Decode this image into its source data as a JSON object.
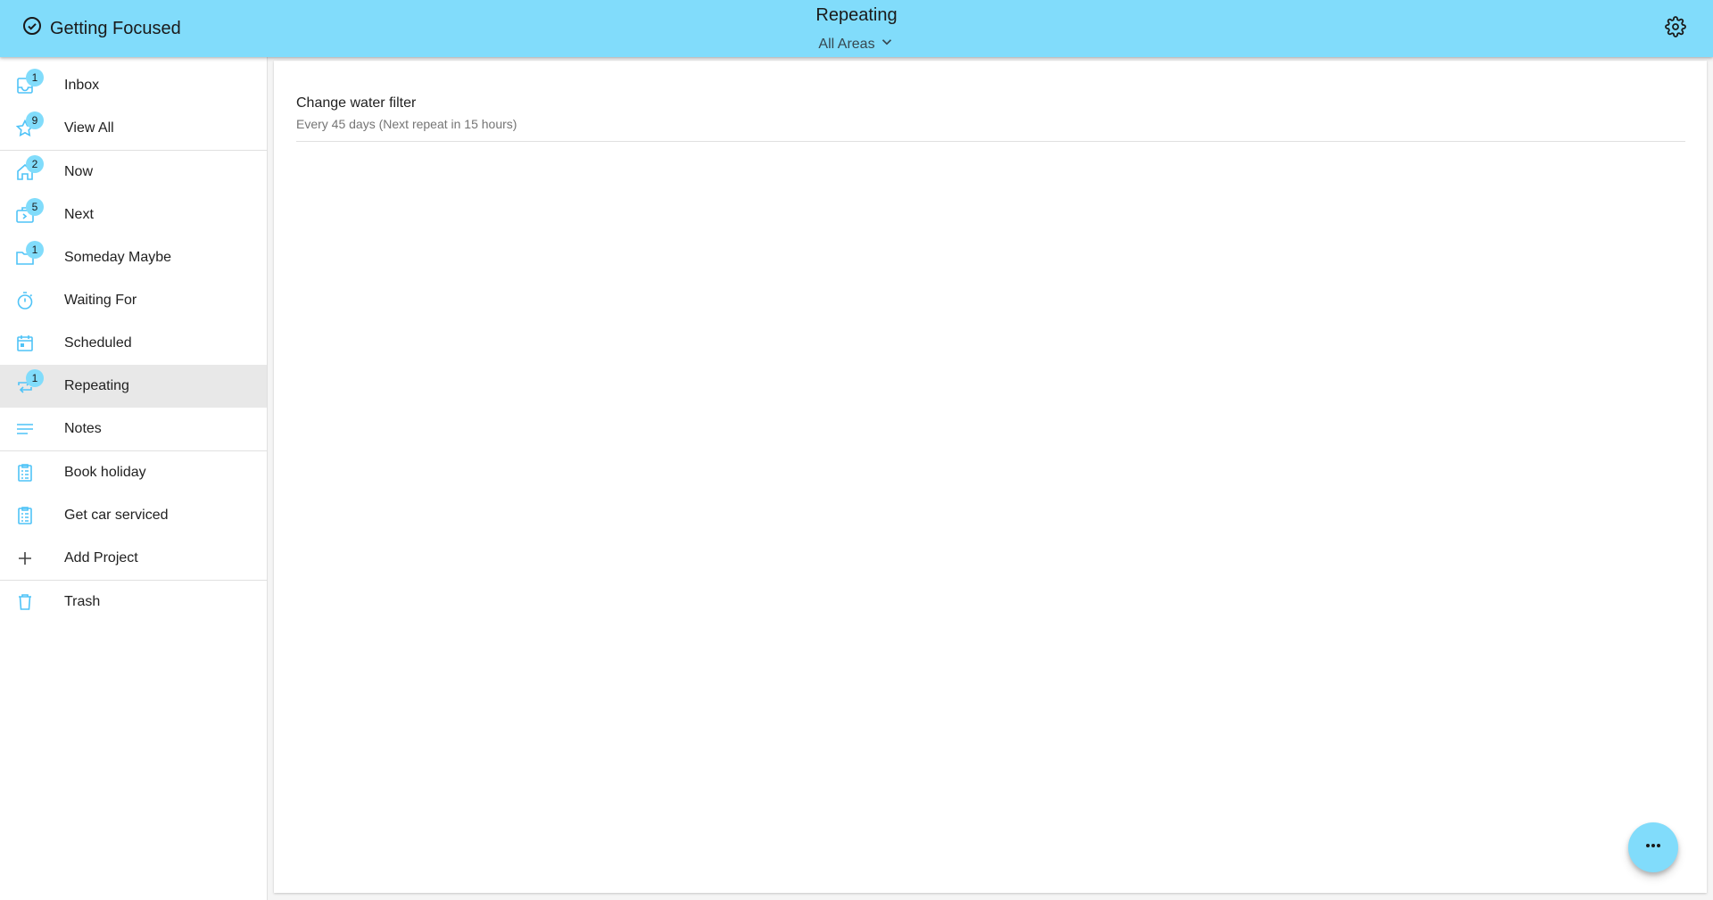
{
  "header": {
    "brand": "Getting Focused",
    "title": "Repeating",
    "area_filter": "All Areas"
  },
  "sidebar": {
    "groups": [
      {
        "items": [
          {
            "label": "Inbox",
            "badge": "1",
            "icon": "inbox-icon"
          },
          {
            "label": "View All",
            "badge": "9",
            "icon": "star-icon"
          }
        ]
      },
      {
        "items": [
          {
            "label": "Now",
            "badge": "2",
            "icon": "home-icon"
          },
          {
            "label": "Next",
            "badge": "5",
            "icon": "next-box-icon"
          },
          {
            "label": "Someday Maybe",
            "badge": "1",
            "icon": "folder-icon"
          },
          {
            "label": "Waiting For",
            "badge": "",
            "icon": "stopwatch-icon"
          },
          {
            "label": "Scheduled",
            "badge": "",
            "icon": "calendar-icon"
          },
          {
            "label": "Repeating",
            "badge": "1",
            "icon": "repeat-icon",
            "selected": true
          },
          {
            "label": "Notes",
            "badge": "",
            "icon": "notes-icon"
          }
        ]
      },
      {
        "items": [
          {
            "label": "Book holiday",
            "badge": "",
            "icon": "clipboard-list-icon"
          },
          {
            "label": "Get car serviced",
            "badge": "",
            "icon": "clipboard-list-icon"
          },
          {
            "label": "Add Project",
            "badge": "",
            "icon": "plus-icon"
          }
        ]
      },
      {
        "items": [
          {
            "label": "Trash",
            "badge": "",
            "icon": "trash-icon"
          }
        ]
      }
    ]
  },
  "tasks": [
    {
      "title": "Change water filter",
      "subtitle": "Every 45 days (Next repeat in 15 hours)"
    }
  ],
  "colors": {
    "accent": "#81dcfb",
    "icon": "#4fc3f7"
  }
}
